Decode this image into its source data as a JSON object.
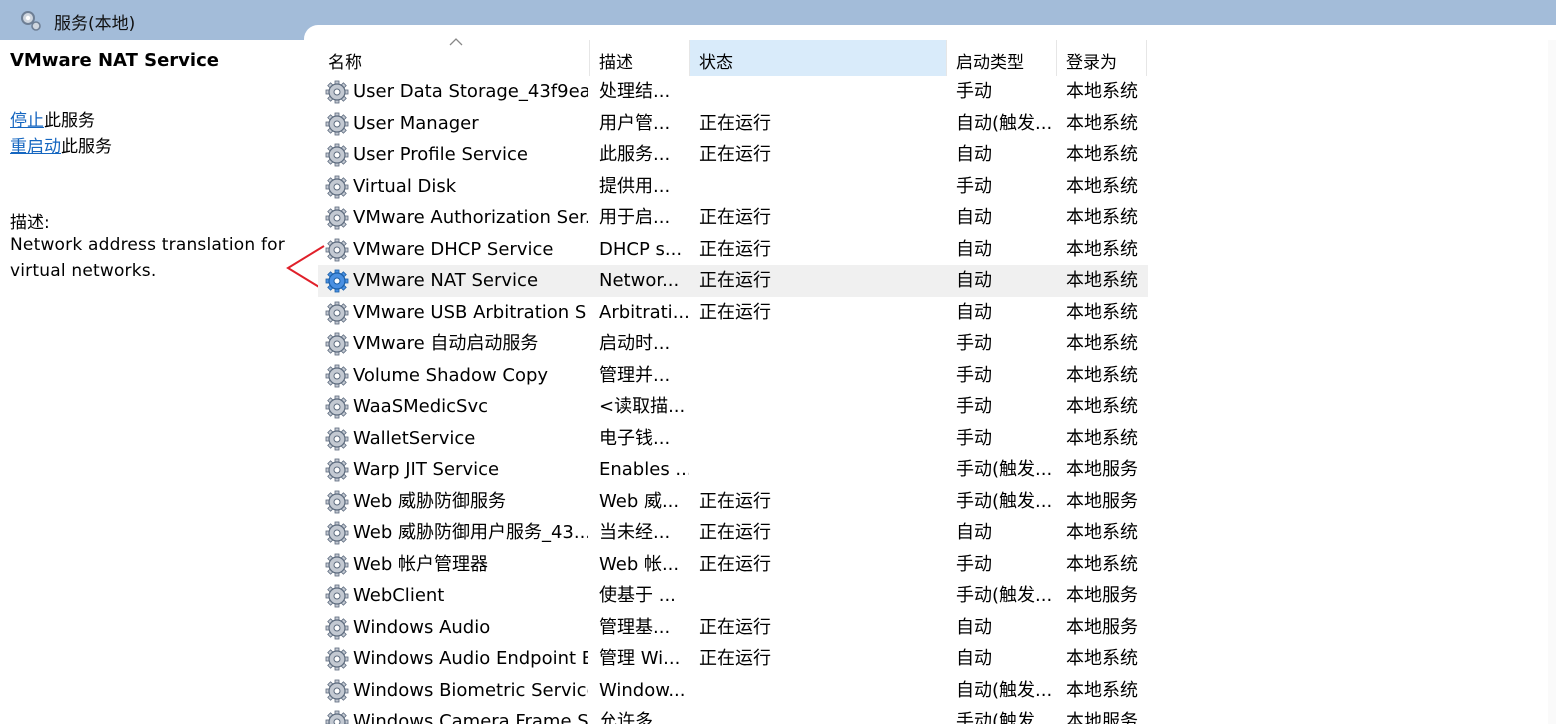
{
  "window": {
    "title": "服务(本地)"
  },
  "left_pane": {
    "service_title": "VMware NAT Service",
    "actions": [
      {
        "link": "停止",
        "suffix": "此服务"
      },
      {
        "link": "重启动",
        "suffix": "此服务"
      }
    ],
    "description_label": "描述:",
    "description_text": "Network address translation for virtual networks."
  },
  "table": {
    "columns": [
      "名称",
      "描述",
      "状态",
      "启动类型",
      "登录为"
    ],
    "rows": [
      [
        "User Data Storage_43f9ea",
        "处理结...",
        "",
        "手动",
        "本地系统"
      ],
      [
        "User Manager",
        "用户管...",
        "正在运行",
        "自动(触发...",
        "本地系统"
      ],
      [
        "User Profile Service",
        "此服务...",
        "正在运行",
        "自动",
        "本地系统"
      ],
      [
        "Virtual Disk",
        "提供用...",
        "",
        "手动",
        "本地系统"
      ],
      [
        "VMware Authorization Ser...",
        "用于启...",
        "正在运行",
        "自动",
        "本地系统"
      ],
      [
        "VMware DHCP Service",
        "DHCP s...",
        "正在运行",
        "自动",
        "本地系统"
      ],
      [
        "VMware NAT Service",
        "Networ...",
        "正在运行",
        "自动",
        "本地系统"
      ],
      [
        "VMware USB Arbitration S...",
        "Arbitrati...",
        "正在运行",
        "自动",
        "本地系统"
      ],
      [
        "VMware 自动启动服务",
        "启动时...",
        "",
        "手动",
        "本地系统"
      ],
      [
        "Volume Shadow Copy",
        "管理并...",
        "",
        "手动",
        "本地系统"
      ],
      [
        "WaaSMedicSvc",
        "<读取描...",
        "",
        "手动",
        "本地系统"
      ],
      [
        "WalletService",
        "电子钱...",
        "",
        "手动",
        "本地系统"
      ],
      [
        "Warp JIT Service",
        "Enables ...",
        "",
        "手动(触发...",
        "本地服务"
      ],
      [
        "Web 威胁防御服务",
        "Web 威...",
        "正在运行",
        "手动(触发...",
        "本地服务"
      ],
      [
        "Web 威胁防御用户服务_43...",
        "当未经...",
        "正在运行",
        "自动",
        "本地系统"
      ],
      [
        "Web 帐户管理器",
        "Web 帐...",
        "正在运行",
        "手动",
        "本地系统"
      ],
      [
        "WebClient",
        "使基于 ...",
        "",
        "手动(触发...",
        "本地服务"
      ],
      [
        "Windows Audio",
        "管理基...",
        "正在运行",
        "自动",
        "本地服务"
      ],
      [
        "Windows Audio Endpoint B...",
        "管理 Wi...",
        "正在运行",
        "自动",
        "本地系统"
      ],
      [
        "Windows Biometric Service",
        "Window...",
        "",
        "自动(触发...",
        "本地系统"
      ],
      [
        "Windows Camera Frame S...",
        "允许多...",
        "",
        "手动(触发...",
        "本地服务"
      ]
    ],
    "selected_row": 6
  },
  "colors": {
    "titlebar": "#a3bcd9",
    "link": "#1566c0",
    "status_header": "#d9ebfa",
    "selected_row": "#f0f0f0",
    "arrow": "#e0202a"
  }
}
